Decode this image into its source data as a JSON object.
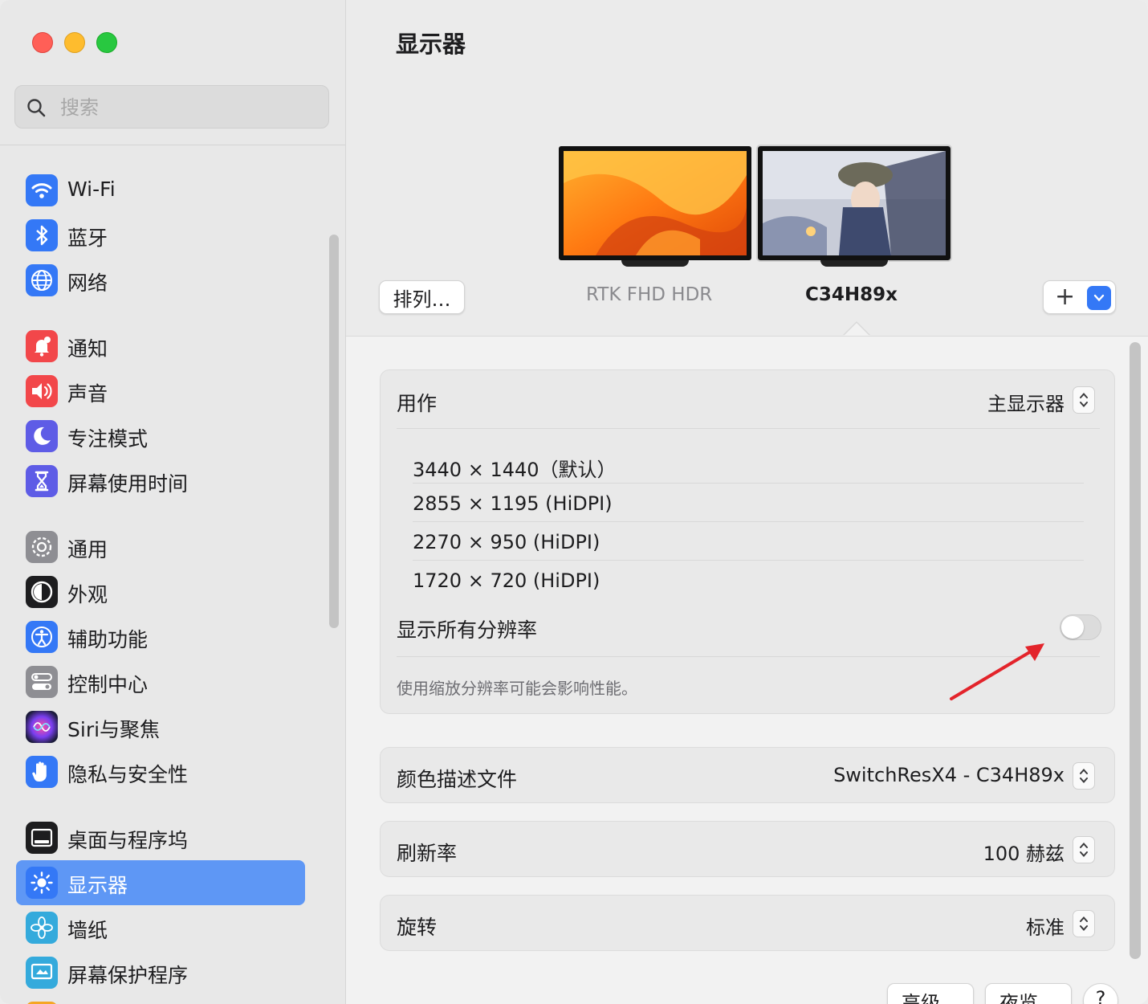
{
  "sidebar": {
    "search_placeholder": "搜索",
    "items": [
      {
        "label": "Wi-Fi",
        "icon": "wifi-icon",
        "color": "#3478f6"
      },
      {
        "label": "蓝牙",
        "icon": "bluetooth-icon",
        "color": "#3478f6"
      },
      {
        "label": "网络",
        "icon": "globe-icon",
        "color": "#3478f6"
      },
      {
        "label": "通知",
        "icon": "bell-icon",
        "color": "#f2474a"
      },
      {
        "label": "声音",
        "icon": "speaker-icon",
        "color": "#f2474a"
      },
      {
        "label": "专注模式",
        "icon": "moon-icon",
        "color": "#5e5ce6"
      },
      {
        "label": "屏幕使用时间",
        "icon": "hourglass-icon",
        "color": "#5e5ce6"
      },
      {
        "label": "通用",
        "icon": "gear-icon",
        "color": "#8e8e93"
      },
      {
        "label": "外观",
        "icon": "appearance-icon",
        "color": "#1d1d1f"
      },
      {
        "label": "辅助功能",
        "icon": "accessibility-icon",
        "color": "#3478f6"
      },
      {
        "label": "控制中心",
        "icon": "control-center-icon",
        "color": "#8e8e93"
      },
      {
        "label": "Siri与聚焦",
        "icon": "siri-icon",
        "color": "#c73a8f"
      },
      {
        "label": "隐私与安全性",
        "icon": "hand-icon",
        "color": "#3478f6"
      },
      {
        "label": "桌面与程序坞",
        "icon": "dock-icon",
        "color": "#1d1d1f"
      },
      {
        "label": "显示器",
        "icon": "sun-icon",
        "color": "#3478f6"
      },
      {
        "label": "墙纸",
        "icon": "flower-icon",
        "color": "#34aadc"
      },
      {
        "label": "屏幕保护程序",
        "icon": "screensaver-icon",
        "color": "#34aadc"
      }
    ],
    "selected_index": 14
  },
  "main": {
    "title": "显示器",
    "arrange_button": "排列…",
    "displays": [
      {
        "name": "RTK FHD HDR",
        "selected": false
      },
      {
        "name": "C34H89x",
        "selected": true
      }
    ],
    "add_button": "+",
    "use_as": {
      "label": "用作",
      "value": "主显示器"
    },
    "resolutions": [
      "3440 × 1440（默认）",
      "2855 × 1195 (HiDPI)",
      "2270 × 950 (HiDPI)",
      "1720 × 720 (HiDPI)"
    ],
    "show_all_resolutions": {
      "label": "显示所有分辨率",
      "enabled": false
    },
    "note": "使用缩放分辨率可能会影响性能。",
    "color_profile": {
      "label": "颜色描述文件",
      "value": "SwitchResX4 - C34H89x"
    },
    "refresh_rate": {
      "label": "刷新率",
      "value": "100 赫兹"
    },
    "rotation": {
      "label": "旋转",
      "value": "标准"
    },
    "advanced_button": "高级…",
    "night_shift_button": "夜览…",
    "help_button": "?"
  },
  "colors": {
    "accent": "#5e97f5",
    "annotation_arrow": "#e3242b"
  }
}
